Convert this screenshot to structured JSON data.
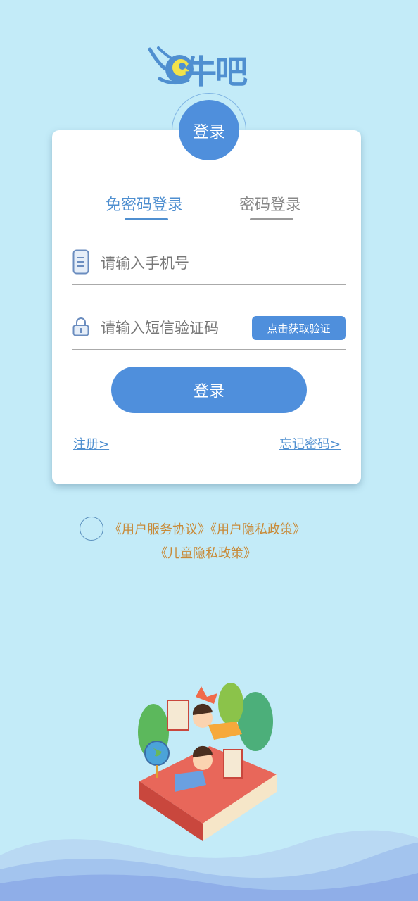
{
  "app": {
    "logo_text": "牛吧"
  },
  "card": {
    "badge_label": "登录",
    "tabs": [
      {
        "label": "免密码登录",
        "active": true
      },
      {
        "label": "密码登录",
        "active": false
      }
    ],
    "phone_placeholder": "请输入手机号",
    "code_placeholder": "请输入短信验证码",
    "get_code_label": "点击获取验证",
    "login_label": "登录",
    "register_link": "注册>",
    "forgot_link": "忘记密码>"
  },
  "agreement": {
    "line1": "《用户服务协议》《用户隐私政策》",
    "line2": "《儿童隐私政策》"
  },
  "colors": {
    "accent": "#4f8fdc",
    "background": "#c3ebf8",
    "agreement_text": "#c88a38"
  }
}
